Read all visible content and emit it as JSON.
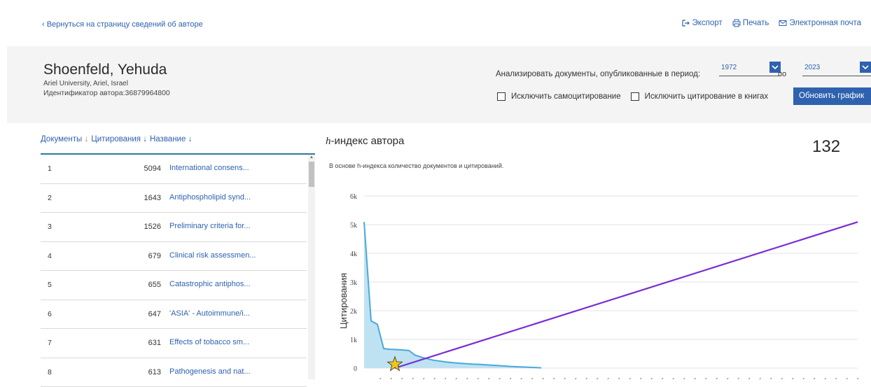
{
  "topbar": {
    "back_link": "‹ Вернуться на страницу сведений об авторе",
    "export": "Экспорт",
    "print": "Печать",
    "email": "Электронная почта"
  },
  "author": {
    "name": "Shoenfeld, Yehuda",
    "affiliation": "Ariel University, Ariel, Israel",
    "id": "Идентификатор автора:36879964800"
  },
  "filters": {
    "period_label": "Анализировать документы, опубликованные в период:",
    "from_year": "1972",
    "to_label": "по",
    "to_year": "2023",
    "exclude_self": "Исключить самоцитирование",
    "exclude_books": "Исключить цитирование в книгах",
    "update_button": "Обновить график"
  },
  "table": {
    "headers": [
      "Документы",
      "Цитирования",
      "Название"
    ],
    "rows": [
      {
        "rank": "1",
        "cites": "5094",
        "title": "International consens..."
      },
      {
        "rank": "2",
        "cites": "1643",
        "title": "Antiphospholipid synd..."
      },
      {
        "rank": "3",
        "cites": "1526",
        "title": "Preliminary criteria for..."
      },
      {
        "rank": "4",
        "cites": "679",
        "title": "Clinical risk assessmen..."
      },
      {
        "rank": "5",
        "cites": "655",
        "title": "Catastrophic antiphos..."
      },
      {
        "rank": "6",
        "cites": "647",
        "title": "'ASIA' - Autoimmune/i..."
      },
      {
        "rank": "7",
        "cites": "631",
        "title": "Effects of tobacco sm..."
      },
      {
        "rank": "8",
        "cites": "613",
        "title": "Pathogenesis and nat..."
      }
    ]
  },
  "hindex": {
    "title_italic": "h",
    "title_rest": "-индекс автора",
    "value": "132",
    "subtitle": "В основе h-индекса количество документов и цитирований."
  },
  "chart_data": {
    "type": "line",
    "ylabel": "Цитирования",
    "yticks": [
      "0",
      "1k",
      "2k",
      "3k",
      "4k",
      "5k",
      "6k"
    ],
    "ylim": [
      0,
      6000
    ],
    "grid": true,
    "series": [
      {
        "values": [
          5094,
          1643,
          1526,
          679,
          655,
          647,
          631,
          613,
          450,
          380,
          320,
          270,
          240,
          210,
          190,
          170,
          155,
          140,
          132,
          120,
          105,
          90,
          75,
          60,
          50,
          40,
          30,
          20,
          10
        ]
      },
      {
        "values": [
          0,
          5094
        ]
      }
    ],
    "colors": {
      "citations": "#4aa9d9",
      "hline": "#7a2ed2",
      "star": "#f0c419",
      "grid": "#e3e3e3"
    }
  }
}
